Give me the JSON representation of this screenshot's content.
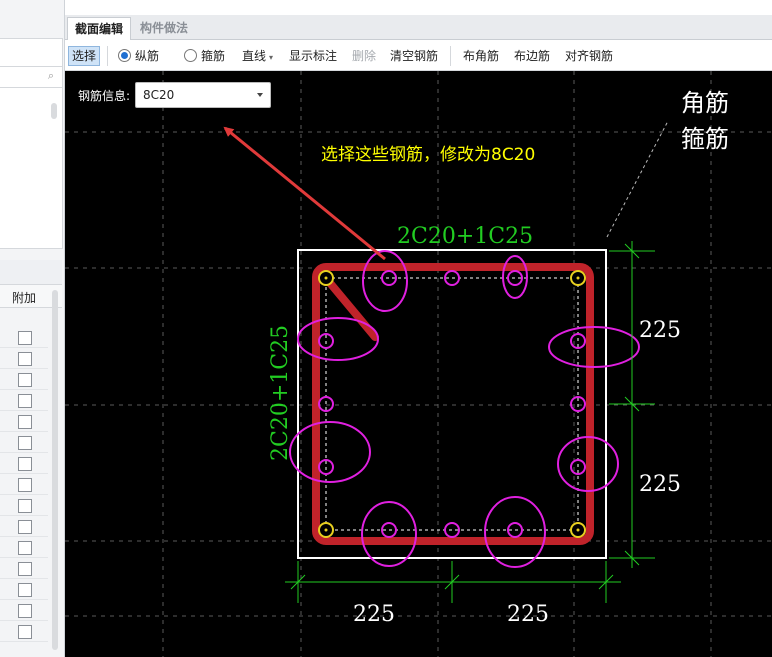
{
  "tabs": [
    {
      "label": "截面编辑",
      "active": true
    },
    {
      "label": "构件做法",
      "active": false
    }
  ],
  "toolbar": {
    "select": "选择",
    "longitudinal": "纵筋",
    "stirrup": "箍筋",
    "line": "直线",
    "show_annotation": "显示标注",
    "delete": "删除",
    "clear_rebar": "清空钢筋",
    "corner_rebar": "布角筋",
    "edge_rebar": "布边筋",
    "align_rebar": "对齐钢筋"
  },
  "rebar_info": {
    "label": "钢筋信息:",
    "value": "8C20"
  },
  "left_panel": {
    "column_header": "附加",
    "checkbox_count": 15
  },
  "annotations": {
    "instruction": "选择这些钢筋，修改为8C20",
    "corner_label_1": "角筋",
    "corner_label_2": "箍筋",
    "top_rebar": "2C20+1C25",
    "left_rebar": "2C20+1C25",
    "dim_right_top": "225",
    "dim_right_bottom": "225",
    "dim_bottom_left": "225",
    "dim_bottom_right": "225"
  },
  "colors": {
    "rebar_frame": "#c0232a",
    "highlight": "#e020e0",
    "corner_bar": "#e8d020",
    "dimension": "#22cc22",
    "arrow": "#e03a3a",
    "instruction_text": "#ffff00"
  }
}
